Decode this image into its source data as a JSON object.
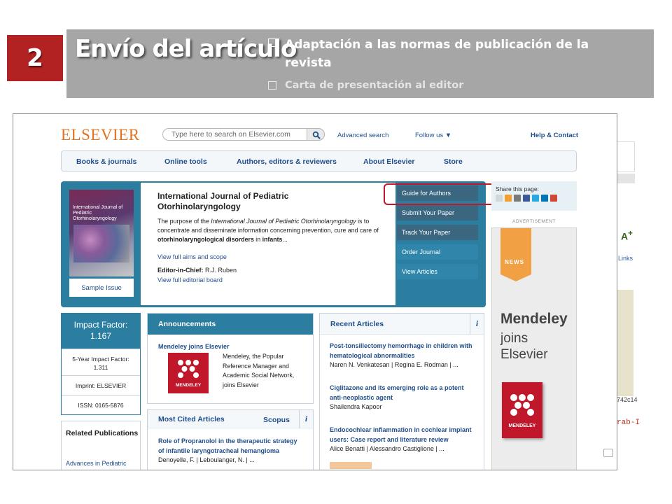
{
  "slide": {
    "step": "2",
    "title": "Envío del artículo",
    "bullets": [
      "Adaptación a las normas de publicación de la revista",
      "Carta de presentación al editor"
    ]
  },
  "header": {
    "logo": "ELSEVIER",
    "search_placeholder": "Type here to search on Elsevier.com",
    "advanced_search": "Advanced search",
    "follow_us": "Follow us ▼",
    "help": "Help & Contact"
  },
  "nav": [
    "Books & journals",
    "Online tools",
    "Authors, editors & reviewers",
    "About Elsevier",
    "Store"
  ],
  "journal": {
    "title": "International Journal of Pediatric Otorhinolaryngology",
    "cover_title": "International Journal of Pediatric Otorhinolaryngology",
    "desc_1": "The purpose of the ",
    "desc_journal": "International Journal of Pediatric Otorhinolaryngology",
    "desc_2": " is to concentrate and disseminate information concerning prevention, cure and care of ",
    "desc_bold": "otorhinolaryngological disorders",
    "desc_3": " in ",
    "desc_bold2": "infants",
    "desc_4": "...",
    "aims_link": "View full aims and scope",
    "editor_label": "Editor-in-Chief:",
    "editor_name": " R.J. Ruben",
    "board_link": "View full editorial board",
    "sample_issue": "Sample Issue"
  },
  "journal_actions": [
    "Guide for Authors",
    "Submit Your Paper",
    "Track Your Paper",
    "Order Journal",
    "View Articles"
  ],
  "share": {
    "label": "Share this page:"
  },
  "advertisement": {
    "label": "ADVERTISEMENT",
    "news": "NEWS",
    "line1": "Mendeley",
    "line2": "joins",
    "line3": "Elsevier",
    "logo_word": "MENDELEY"
  },
  "metrics": {
    "impact_label": "Impact Factor:",
    "impact_value": "1.167",
    "five_year": "5-Year Impact Factor: 1.311",
    "imprint": "Imprint: ELSEVIER",
    "issn": "ISSN: 0165-5876"
  },
  "related": {
    "heading": "Related Publications",
    "link": "Advances in Pediatric"
  },
  "announcements": {
    "heading": "Announcements",
    "item_title": "Mendeley joins Elsevier",
    "item_text": "Mendeley, the Popular Reference Manager and Academic Social Network, joins Elsevier",
    "logo_word": "MENDELEY"
  },
  "most_cited": {
    "heading": "Most Cited Articles",
    "badge": "Scopus",
    "articles": [
      {
        "title": "Role of Propranolol in the therapeutic strategy of infantile laryngotracheal hemangioma",
        "authors": "Denoyelle, F. | Leboulanger, N. | ..."
      }
    ]
  },
  "recent": {
    "heading": "Recent Articles",
    "articles": [
      {
        "title": "Post-tonsillectomy hemorrhage in children with hematological abnormalities",
        "authors": "Naren N. Venkatesan | Regina E. Rodman | ..."
      },
      {
        "title": "Ciglitazone and its emerging role as a potent anti-neoplastic agent",
        "authors": "Shailendra Kapoor"
      },
      {
        "title": "Endocochlear inflammation in cochlear implant users: Case report and literature review",
        "authors": "Alice Benatti | Alessandro Castiglione | ..."
      }
    ]
  },
  "background_window": {
    "font_button": "A",
    "links": "Links",
    "code": "742c14",
    "red_text": "rab-I"
  },
  "colors": {
    "badge_red": "#b22222",
    "header_gray": "#a6a6a6",
    "elsevier_orange": "#e27322",
    "site_blue": "#2c7ea1",
    "link_blue": "#1f4e8c",
    "highlight_red": "#c0172a",
    "mendeley_red": "#c0172a"
  },
  "icons": [
    "search-icon",
    "info-icon",
    "share-icons",
    "mendeley-logo-icon"
  ]
}
